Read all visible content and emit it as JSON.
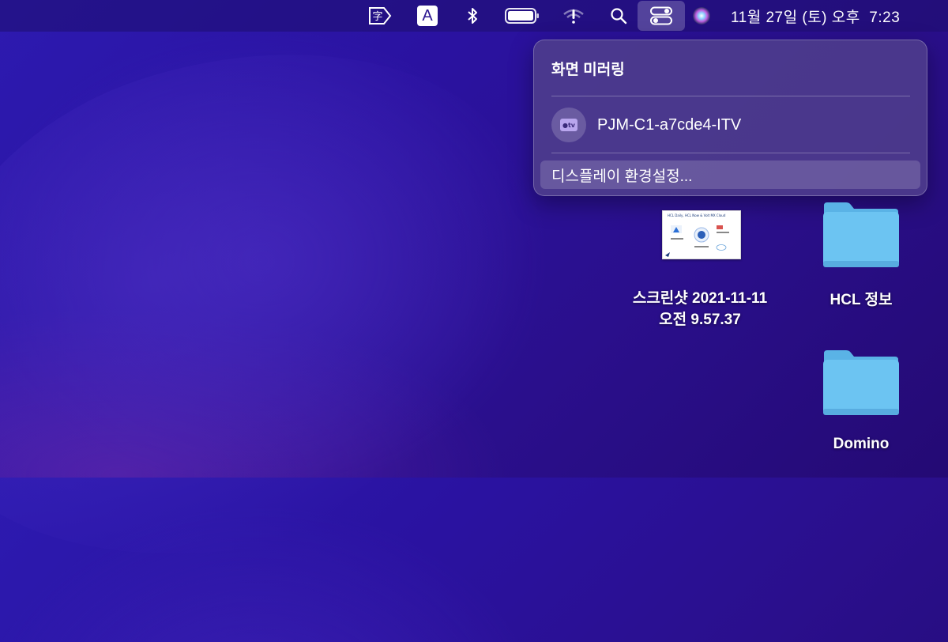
{
  "menubar": {
    "icons": [
      "chinese-input-icon",
      "input-source-a-icon",
      "bluetooth-icon",
      "battery-icon",
      "wifi-alert-icon",
      "search-icon",
      "control-center-icon",
      "siri-icon"
    ],
    "input_letter": "A",
    "clock": "11월 27일 (토) 오후  7:23"
  },
  "popup": {
    "title": "화면 미러링",
    "device": {
      "icon_label": "tv",
      "name": "PJM-C1-a7cde4-ITV"
    },
    "settings_label": "디스플레이 환경설정..."
  },
  "desktop": {
    "screenshot": {
      "title_line1": "스크린샷 2021-11-11",
      "title_line2": "오전 9.57.37",
      "thumb_heading": "HCL Daily, HCL Now & Volt MX Cloud"
    },
    "folders": [
      {
        "label": "HCL 정보"
      },
      {
        "label": "Domino"
      }
    ]
  },
  "colors": {
    "folder": "#6cc4f2",
    "folder_tab": "#5ab3e6",
    "accent": "#b9a6ee"
  }
}
